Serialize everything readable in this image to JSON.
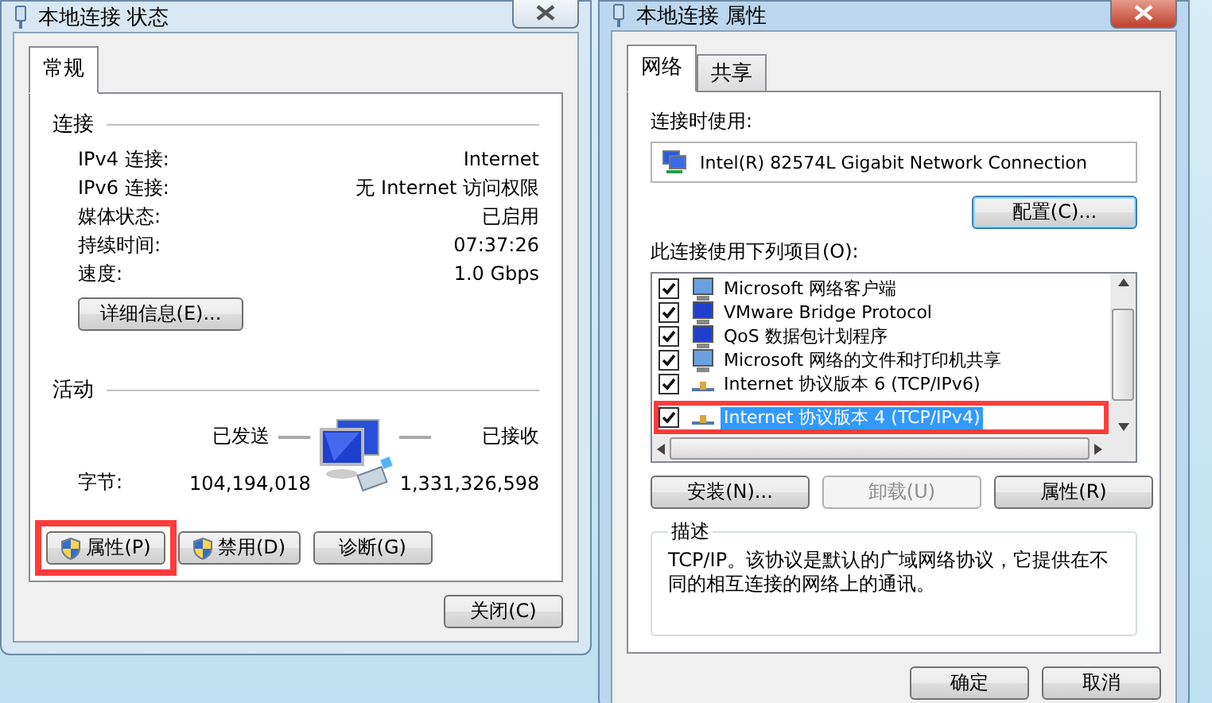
{
  "status_window": {
    "title": "本地连接 状态",
    "active": false,
    "tabs": [
      {
        "label": "常规",
        "selected": true
      }
    ],
    "connection": {
      "heading": "连接",
      "rows": [
        {
          "label": "IPv4 连接:",
          "value": "Internet"
        },
        {
          "label": "IPv6 连接:",
          "value": "无 Internet 访问权限"
        },
        {
          "label": "媒体状态:",
          "value": "已启用"
        },
        {
          "label": "持续时间:",
          "value": "07:37:26"
        },
        {
          "label": "速度:",
          "value": "1.0 Gbps"
        }
      ]
    },
    "details_button": "详细信息(E)...",
    "activity": {
      "heading": "活动",
      "sent_label": "已发送",
      "received_label": "已接收",
      "bytes_label": "字节:",
      "sent": "104,194,018",
      "received": "1,331,326,598"
    },
    "buttons": [
      {
        "label": "属性(P)",
        "shield": true,
        "highlighted": true
      },
      {
        "label": "禁用(D)",
        "shield": true,
        "highlighted": false
      },
      {
        "label": "诊断(G)",
        "shield": false,
        "highlighted": false
      }
    ],
    "close_button": "关闭(C)"
  },
  "properties_window": {
    "title": "本地连接 属性",
    "active": true,
    "tabs": [
      {
        "label": "网络",
        "selected": true
      },
      {
        "label": "共享",
        "selected": false
      }
    ],
    "connect_using_label": "连接时使用:",
    "adapter": "Intel(R) 82574L Gigabit Network Connection",
    "configure_button": "配置(C)...",
    "items_label": "此连接使用下列项目(O):",
    "items": [
      {
        "label": "Microsoft 网络客户端",
        "checked": true,
        "selected": false,
        "highlighted": false
      },
      {
        "label": "VMware Bridge Protocol",
        "checked": true,
        "selected": false,
        "highlighted": false
      },
      {
        "label": "QoS 数据包计划程序",
        "checked": true,
        "selected": false,
        "highlighted": false
      },
      {
        "label": "Microsoft 网络的文件和打印机共享",
        "checked": true,
        "selected": false,
        "highlighted": false
      },
      {
        "label": "Internet 协议版本 6 (TCP/IPv6)",
        "checked": true,
        "selected": false,
        "highlighted": false
      },
      {
        "label": "Internet 协议版本 4 (TCP/IPv4)",
        "checked": true,
        "selected": true,
        "highlighted": true
      }
    ],
    "item_buttons": [
      {
        "label": "安装(N)...",
        "disabled": false
      },
      {
        "label": "卸载(U)",
        "disabled": true
      },
      {
        "label": "属性(R)",
        "disabled": false
      }
    ],
    "description": {
      "heading": "描述",
      "text": "TCP/IP。该协议是默认的广域网络协议，它提供在不同的相互连接的网络上的通讯。"
    },
    "dialog_buttons": [
      {
        "label": "确定"
      },
      {
        "label": "取消"
      }
    ]
  }
}
